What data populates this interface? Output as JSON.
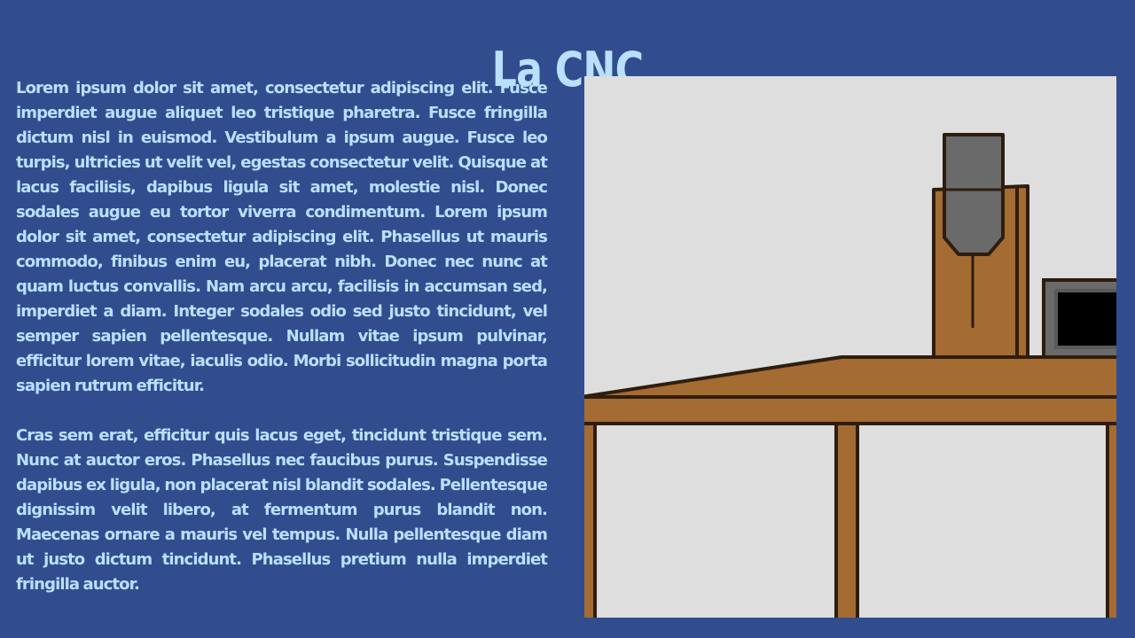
{
  "page": {
    "title": "La CNC",
    "paragraphs": [
      "Lorem ipsum dolor sit amet, consectetur adipiscing elit. Fusce imperdiet augue aliquet leo tristique pharetra. Fusce fringilla dictum nisl in euismod. Vestibulum a ipsum augue. Fusce leo turpis, ultricies ut velit vel, egestas consectetur velit. Quisque at lacus facilisis, dapibus ligula sit amet, molestie nisl. Donec sodales augue eu tortor viverra condimentum. Lorem ipsum dolor sit amet, consectetur adipiscing elit. Phasellus ut mauris commodo, finibus enim eu, placerat nibh. Donec nec nunc at quam luctus convallis. Nam arcu arcu, facilisis in accumsan sed, imperdiet a diam. Integer sodales odio sed justo tincidunt, vel semper sapien pellentesque. Nullam vitae ipsum pulvinar, efficitur lorem vitae, iaculis odio. Morbi sollicitudin magna porta sapien rutrum efficitur.",
      "Cras sem erat, efficitur quis lacus eget, tincidunt tristique sem. Nunc at auctor eros. Phasellus nec faucibus purus. Suspendisse dapibus ex ligula, non placerat nisl blandit sodales. Pellentesque dignissim velit libero, at fermentum purus blandit non. Maecenas ornare a mauris vel tempus. Nulla pellentesque diam ut justo dictum tincidunt. Phasellus pretium nulla imperdiet fringilla auctor."
    ]
  },
  "colors": {
    "background": "#314d8e",
    "text": "#b9e0ff",
    "wood": "#a46b33",
    "outline": "#2e1e0e",
    "tool_gray": "#6a6a6a",
    "illustration_bg": "#dedede",
    "screen": "#000000"
  },
  "illustration": {
    "description_icon": "cnc-machine-illustration"
  }
}
